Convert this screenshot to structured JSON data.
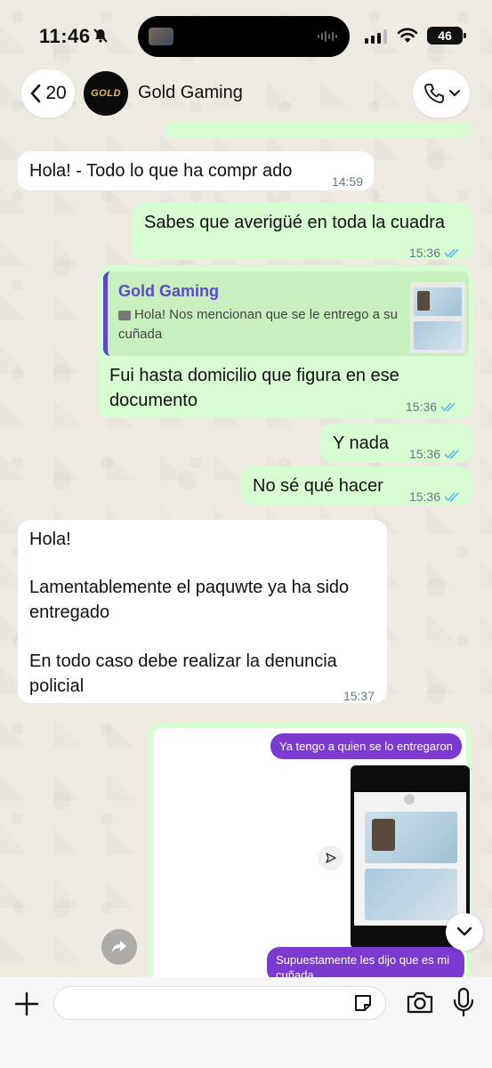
{
  "status": {
    "time": "11:46",
    "battery": "46"
  },
  "header": {
    "back_count": "20",
    "avatar_text": "GOLD",
    "contact_name": "Gold Gaming"
  },
  "messages": [
    {
      "dir": "in",
      "text": "Hola! - Todo lo que ha compr ado",
      "time": "14:59"
    },
    {
      "dir": "out",
      "text": "Sabes que averigüé en toda la cuadra",
      "time": "15:36"
    },
    {
      "dir": "out",
      "quote": {
        "name": "Gold Gaming",
        "text": "Hola! Nos mencionan que se le entrego a su cuñada"
      },
      "text_line1": "Fui hasta domicilio que figura en ese",
      "text_line2": "documento",
      "time": "15:36"
    },
    {
      "dir": "out",
      "text": "Y nada",
      "time": "15:36"
    },
    {
      "dir": "out",
      "text": "No sé qué hacer",
      "time": "15:36"
    },
    {
      "dir": "in",
      "line1": "Hola!",
      "line2": "Lamentablemente el paquwte ya ha sido",
      "line3": "entregado",
      "line4": "En todo caso debe realizar la denuncia",
      "line5": "policial",
      "time": "15:37"
    }
  ],
  "screenshot_card": {
    "bubble1": "Ya tengo a quien se lo entregaron",
    "bubble2_line1": "Supuestamente les dijo que es mi",
    "bubble2_line2": "cuñada"
  },
  "input": {
    "placeholder": ""
  },
  "colors": {
    "incoming": "#ffffff",
    "outgoing": "#d9fdd3",
    "ticks": "#53bdeb",
    "quote_accent": "#5c4ac7",
    "purple_bubble": "#7c3ad1"
  }
}
